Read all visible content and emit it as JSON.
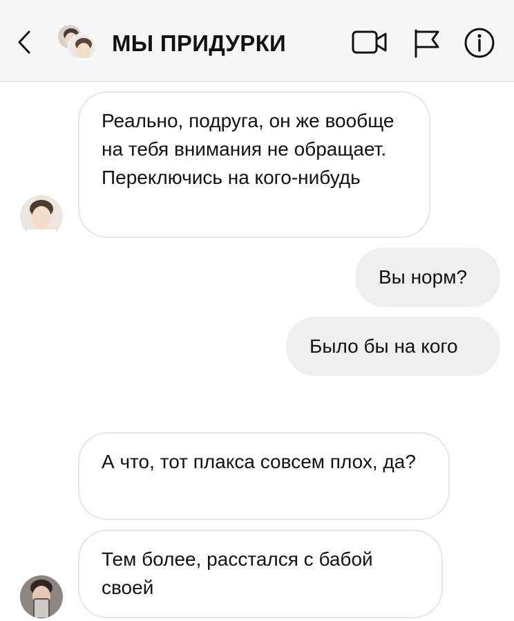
{
  "header": {
    "title": "МЫ ПРИДУРКИ",
    "icons": [
      "chevron-left-icon",
      "video-camera-icon",
      "flag-icon",
      "info-icon"
    ]
  },
  "messages": [
    {
      "direction": "incoming",
      "text": "Реально, подруга, он же вообще на тебя внимания не обращает. Переключись на кого-нибудь"
    },
    {
      "direction": "outgoing",
      "text": "Вы норм?"
    },
    {
      "direction": "outgoing",
      "text": "Было бы на кого"
    },
    {
      "direction": "incoming",
      "text": "А что, тот плакса совсем плох, да?"
    },
    {
      "direction": "incoming",
      "text": "Тем более, расстался с бабой своей"
    }
  ],
  "colors": {
    "header_bg": "#f7f7f9",
    "outgoing_bubble": "#efeff1",
    "incoming_border": "#e6e6ea"
  }
}
